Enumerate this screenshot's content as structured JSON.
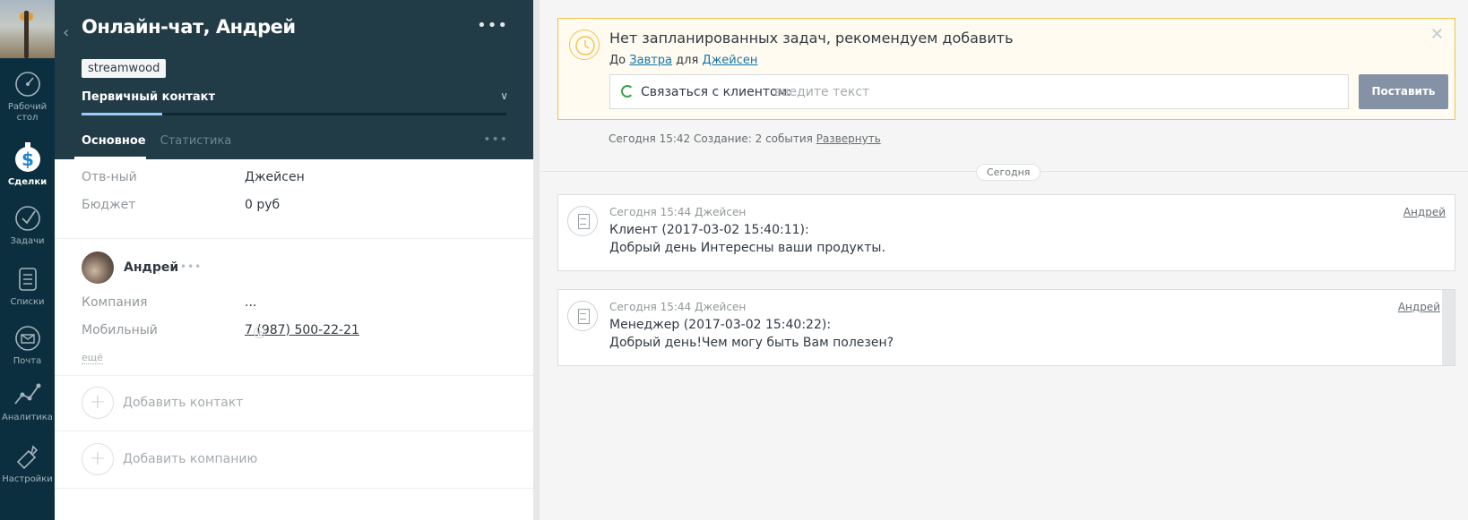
{
  "nav": {
    "items": [
      {
        "label": "Рабочий стол",
        "icon": "dashboard-icon"
      },
      {
        "label": "Сделки",
        "icon": "deals-icon",
        "active": true
      },
      {
        "label": "Задачи",
        "icon": "tasks-icon"
      },
      {
        "label": "Списки",
        "icon": "lists-icon"
      },
      {
        "label": "Почта",
        "icon": "mail-icon"
      },
      {
        "label": "Аналитика",
        "icon": "analytics-icon"
      },
      {
        "label": "Настройки",
        "icon": "settings-icon"
      }
    ]
  },
  "card": {
    "title": "Онлайн-чат, Андрей",
    "tag": "streamwood",
    "stage": "Первичный контакт",
    "stage_progress": 0.19,
    "tabs": [
      "Основное",
      "Статистика"
    ],
    "fields": [
      {
        "label": "Отв-ный",
        "value": "Джейсен"
      },
      {
        "label": "Бюджет",
        "value": "0 руб"
      }
    ],
    "contact": {
      "name": "Андрей",
      "company_label": "Компания",
      "company_value": "...",
      "phone_label": "Мобильный",
      "phone_value": "7 (987) 500-22-21",
      "more": "ещё"
    },
    "add_contact": "Добавить контакт",
    "add_company": "Добавить компанию"
  },
  "task": {
    "title": "Нет запланированных задач, рекомендуем добавить",
    "prefix_to": "До",
    "when": "Завтра",
    "prefix_for": "для",
    "who": "Джейсен",
    "input_label": "Связаться с клиентом:",
    "input_placeholder": "введите текст",
    "submit": "Поставить"
  },
  "feed": {
    "summary": "Сегодня 15:42 Создание: 2 события",
    "expand": "Развернуть",
    "date_pill": "Сегодня",
    "messages": [
      {
        "meta": "Сегодня 15:44 Джейсен",
        "author": "Андрей",
        "line1": "Клиент (2017-03-02 15:40:11):",
        "line2": "Добрый день Интересны ваши продукты."
      },
      {
        "meta": "Сегодня 15:44 Джейсен",
        "author": "Андрей",
        "line1": "Менеджер (2017-03-02 15:40:22):",
        "line2": "Добрый день!Чем могу быть Вам полезен?"
      }
    ]
  },
  "colors": {
    "nav_bg": "#0b2f3f",
    "header_bg": "#223c47",
    "task_border": "#f0c14d",
    "link": "#1375ab",
    "submit_bg": "#8591a5"
  }
}
